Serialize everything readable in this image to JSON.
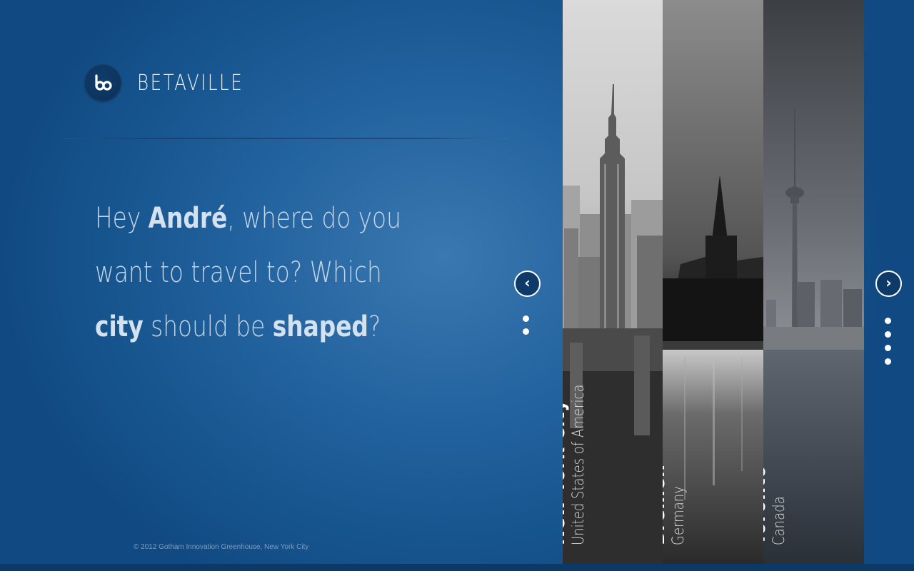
{
  "brand": {
    "name": "BETAVILLE",
    "logo_mark": "bo"
  },
  "headline": {
    "line1_pre": "Hey ",
    "user_name": "André",
    "line1_post": ", where do you",
    "line2": "want to travel to? Which",
    "city_word": "city",
    "line3_mid": " should be ",
    "shaped_word": "shaped",
    "line3_end": "?"
  },
  "footer": {
    "copyright": "© 2012 Gotham Innovation Greenhouse, New York City"
  },
  "nav": {
    "prev_icon": "‹",
    "next_icon": "›"
  },
  "pager_left": {
    "dots": 2
  },
  "pager_right": {
    "dots": 4
  },
  "cities": [
    {
      "name": "New York City",
      "country": "United States of America"
    },
    {
      "name": "Bremen",
      "country": "Germany"
    },
    {
      "name": "Toronto",
      "country": "Canada"
    }
  ],
  "colors": {
    "background": "#1c5a96",
    "accent_dark": "#0d3a69",
    "white": "#ffffff"
  }
}
